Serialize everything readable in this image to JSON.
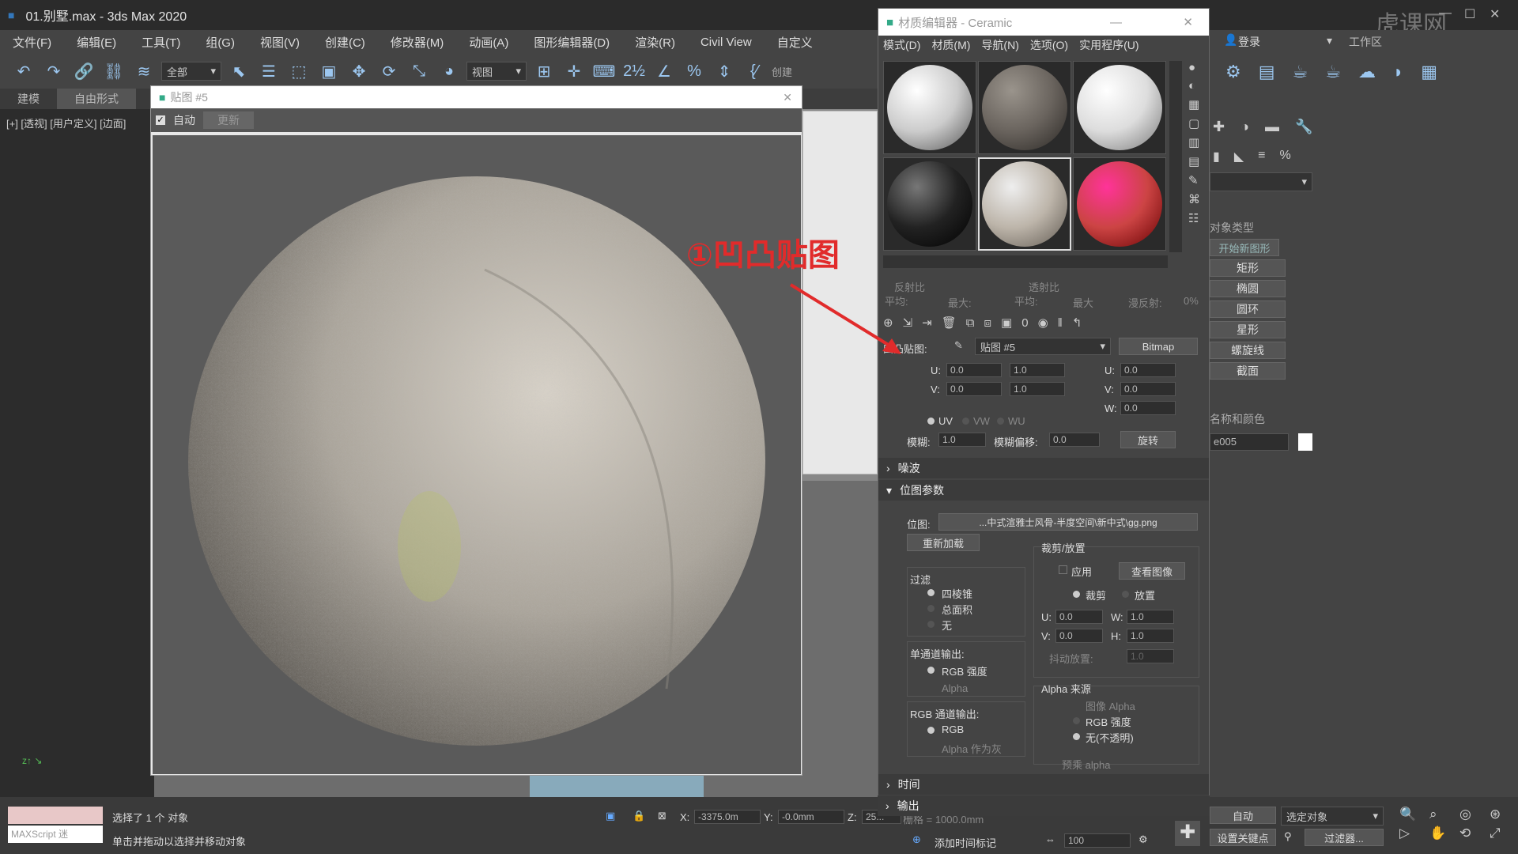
{
  "window": {
    "title": "01.别墅.max - 3ds Max 2020",
    "watermark": "虎课网"
  },
  "menu": [
    "文件(F)",
    "编辑(E)",
    "工具(T)",
    "组(G)",
    "视图(V)",
    "创建(C)",
    "修改器(M)",
    "动画(A)",
    "图形编辑器(D)",
    "渲染(R)",
    "Civil View",
    "自定义"
  ],
  "toolbar": {
    "selection_filter": "全部",
    "ref_coord": "视图",
    "create_label": "创建"
  },
  "ribbon": {
    "tabs": [
      "建模",
      "自由形式"
    ]
  },
  "viewport": {
    "label": "[+] [透视] [用户定义] [边面]"
  },
  "mapwin": {
    "title": "贴图 #5",
    "auto_label": "自动",
    "update_label": "更新"
  },
  "mated": {
    "title": "材质编辑器 - Ceramic",
    "menu": [
      "模式(D)",
      "材质(M)",
      "导航(N)",
      "选项(O)",
      "实用程序(U)"
    ],
    "reflect_label": "反射比",
    "reflect_avg": "平均:",
    "reflect_max": "最大:",
    "refract_label": "透射比",
    "refract_avg": "平均:",
    "refract_max": "最大",
    "diffuse_label": "漫反射:",
    "diffuse_val": "0%",
    "bump_label": "凹凸贴图:",
    "map_name": "贴图 #5",
    "map_type": "Bitmap",
    "coords": {
      "u_offset": "0.0",
      "v_offset": "0.0",
      "u_tile": "1.0",
      "v_tile": "1.0",
      "u_angle": "0.0",
      "v_angle": "0.0",
      "w_angle": "0.0",
      "u_label": "U:",
      "v_label": "V:",
      "w_label": "W:",
      "uv": "UV",
      "vw": "VW",
      "wu": "WU",
      "blur_label": "模糊:",
      "blur": "1.0",
      "blur_off_label": "模糊偏移:",
      "blur_off": "0.0",
      "rotate": "旋转"
    },
    "noise_section": "噪波",
    "bitmap_section": "位图参数",
    "bitmap_label": "位图:",
    "bitmap_path": "...中式渲雅士风骨-半度空间\\新中式\\gg.png",
    "reload": "重新加载",
    "filter_label": "过滤",
    "filters": [
      "四棱锥",
      "总面积",
      "无"
    ],
    "mono_label": "单通道输出:",
    "mono": [
      "RGB 强度",
      "Alpha"
    ],
    "rgb_label": "RGB 通道输出:",
    "rgb": [
      "RGB",
      "Alpha 作为灰"
    ],
    "crop_label": "裁剪/放置",
    "apply": "应用",
    "view_image": "查看图像",
    "crop": "裁剪",
    "place": "放置",
    "crop_vals": {
      "u": "0.0",
      "v": "0.0",
      "w": "1.0",
      "h": "1.0",
      "jitter": "1.0"
    },
    "crop_labels": {
      "u": "U:",
      "v": "V:",
      "w": "W:",
      "h": "H:"
    },
    "jitter_label": "抖动放置:",
    "alpha_src_label": "Alpha 来源",
    "alpha_src": [
      "图像 Alpha",
      "RGB 强度",
      "无(不透明)"
    ],
    "premult": "预乘 alpha",
    "time_section": "时间",
    "output_section": "输出"
  },
  "annotation": {
    "text": "①凹凸贴图",
    "color": "#e12b2b"
  },
  "cmdpanel": {
    "login": "登录",
    "workspace": "工作区",
    "rollout_label": "对象类型",
    "start_shape": "开始新图形",
    "shapes": [
      "矩形",
      "椭圆",
      "圆环",
      "星形",
      "螺旋线",
      "截面"
    ],
    "name_label": "名称和颜色",
    "name": "e005"
  },
  "status": {
    "maxscript": "MAXScript 迷",
    "selected": "选择了 1 个 对象",
    "hint": "单击并拖动以选择并移动对象",
    "x_label": "X:",
    "x": "-3375.0m",
    "y_label": "Y:",
    "y": "-0.0mm",
    "z_label": "Z:",
    "z": "25...",
    "grid": "栅格 = 1000.0mm",
    "add_time_tag": "添加时间标记",
    "frame": "100",
    "auto": "自动",
    "selected_obj": "选定对象",
    "set_key": "设置关键点",
    "filters": "过滤器..."
  }
}
